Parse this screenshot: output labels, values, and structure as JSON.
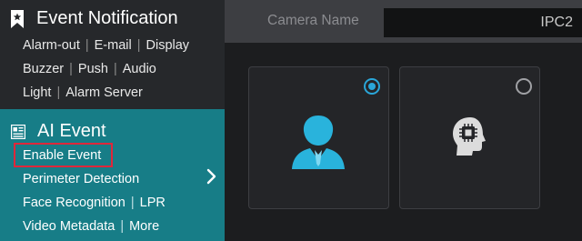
{
  "sidebar": {
    "event_notification": {
      "title": "Event Notification",
      "icon": "bookmark-star-icon",
      "rows": [
        [
          "Alarm-out",
          "E-mail",
          "Display"
        ],
        [
          "Buzzer",
          "Push",
          "Audio"
        ],
        [
          "Light",
          "Alarm Server"
        ]
      ]
    },
    "ai_event": {
      "title": "AI Event",
      "icon": "ai-event-icon",
      "items": {
        "enable_event": "Enable Event",
        "perimeter_detection": "Perimeter Detection",
        "face_recognition": "Face Recognition",
        "lpr": "LPR",
        "video_metadata": "Video Metadata",
        "more": "More"
      }
    },
    "colors": {
      "panel_bg": "#26282b",
      "ai_bg": "#177d87",
      "highlight": "#e0273a"
    }
  },
  "main": {
    "camera_name_label": "Camera Name",
    "camera_name_value": "IPC2",
    "cards": [
      {
        "icon": "person-icon",
        "selected": true
      },
      {
        "icon": "ai-head-icon",
        "selected": false
      }
    ],
    "colors": {
      "accent": "#2aa6d8",
      "person": "#29b3dc"
    }
  }
}
